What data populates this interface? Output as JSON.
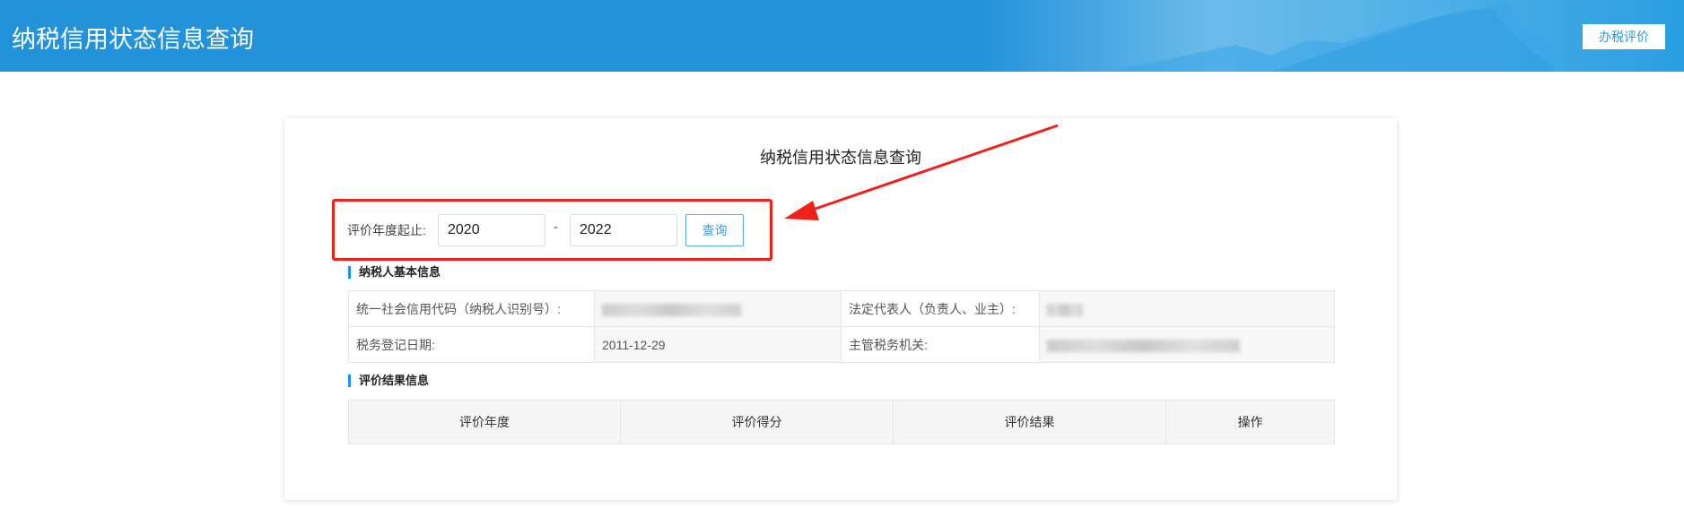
{
  "header": {
    "title": "纳税信用状态信息查询",
    "button": "办税评价"
  },
  "card": {
    "title": "纳税信用状态信息查询"
  },
  "query": {
    "label": "评价年度起止:",
    "start_year": "2020",
    "separator": "-",
    "end_year": "2022",
    "button": "查询"
  },
  "basic_info": {
    "heading": "纳税人基本信息",
    "credit_code_label": "统一社会信用代码（纳税人识别号）:",
    "legal_rep_label": "法定代表人（负责人、业主）:",
    "reg_date_label": "税务登记日期:",
    "reg_date": "2011-12-29",
    "tax_authority_label": "主管税务机关:"
  },
  "results": {
    "heading": "评价结果信息",
    "columns": [
      "评价年度",
      "评价得分",
      "评价结果",
      "操作"
    ]
  },
  "colors": {
    "header": "#2292da",
    "annotation": "#f0201a",
    "accent": "#1890ff"
  }
}
